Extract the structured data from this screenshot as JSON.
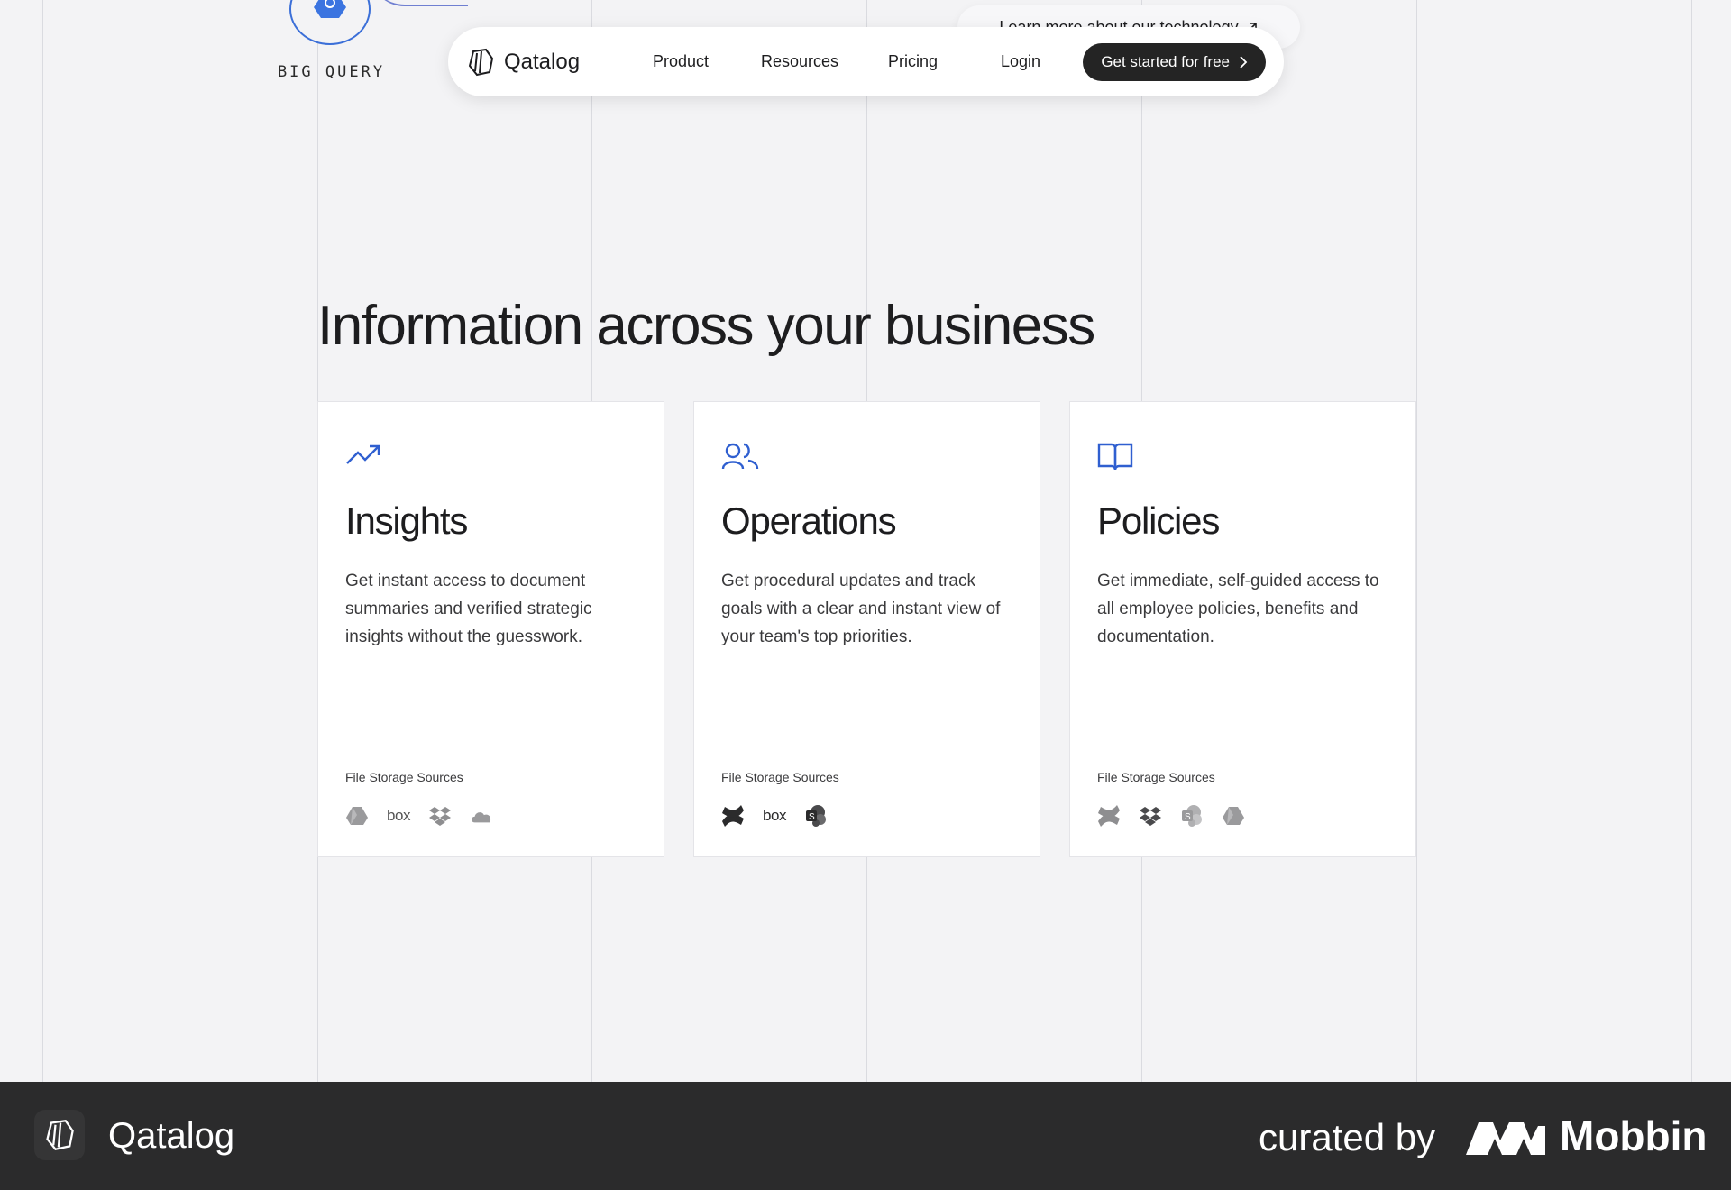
{
  "background_color": "#f3f3f5",
  "bigquery": {
    "label": "BIG QUERY",
    "icon": "bigquery-icon"
  },
  "tech_link": {
    "label": "Learn more about our technology"
  },
  "nav": {
    "logo_text": "Qatalog",
    "links": [
      "Product",
      "Resources",
      "Pricing",
      "Login"
    ],
    "cta_label": "Get started for free"
  },
  "headline": "Information across your business",
  "cards": [
    {
      "icon": "trending-up-icon",
      "title": "Insights",
      "description": "Get instant access to document summaries and verified strategic insights without the guesswork.",
      "sources_label": "File Storage Sources",
      "sources": [
        "google-drive",
        "box",
        "dropbox",
        "onedrive"
      ]
    },
    {
      "icon": "users-icon",
      "title": "Operations",
      "description": "Get procedural updates and track goals with a clear and instant view of your team's top priorities.",
      "sources_label": "File Storage Sources",
      "sources": [
        "confluence",
        "box",
        "sharepoint"
      ]
    },
    {
      "icon": "book-open-icon",
      "title": "Policies",
      "description": "Get immediate, self-guided access to all employee policies, benefits and documentation.",
      "sources_label": "File Storage Sources",
      "sources": [
        "confluence",
        "dropbox",
        "sharepoint",
        "google-drive"
      ]
    }
  ],
  "accent_color": "#2f5fd0",
  "footer": {
    "brand": "Qatalog",
    "curated_by": "curated by",
    "mobbin": "Mobbin",
    "background": "#2b2b2c"
  }
}
